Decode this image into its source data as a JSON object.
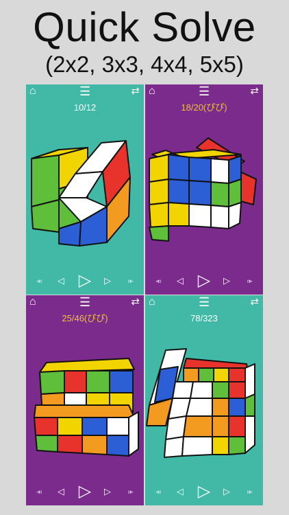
{
  "header": {
    "title": "Quick Solve",
    "subtitle": "(2x2, 3x3, 4x4, 5x5)"
  },
  "icons": {
    "home": "home-icon",
    "menu": "menu-icon",
    "swap": "swap-icon",
    "rewind": "rewind-icon",
    "step_back": "step-back-icon",
    "play": "play-icon",
    "step_forward": "step-forward-icon",
    "fast_forward": "fast-forward-icon"
  },
  "panels": [
    {
      "counter": "10/12",
      "background": "#41b9a6",
      "counter_color": "#ffffff"
    },
    {
      "counter": "18/20(ぴぴ)",
      "background": "#7a2b8c",
      "counter_color": "#f2c233"
    },
    {
      "counter": "25/46(ぴぴ)",
      "background": "#7a2b8c",
      "counter_color": "#f2c233"
    },
    {
      "counter": "78/323",
      "background": "#41b9a6",
      "counter_color": "#ffffff"
    }
  ],
  "glyphs": {
    "home": "⌂",
    "menu": "☰",
    "swap": "⇄",
    "rewind": "◃◃",
    "step_back": "◁",
    "play": "▷",
    "step_forward": "▷",
    "fast_forward": "▹▹"
  }
}
